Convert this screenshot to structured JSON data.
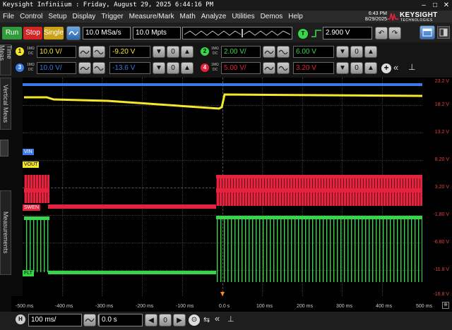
{
  "window": {
    "title": "Keysight Infiniium : Friday, August 29, 2025 6:44:16 PM",
    "date_time": "6:43 PM\n8/29/2025"
  },
  "menu": [
    "File",
    "Control",
    "Setup",
    "Display",
    "Trigger",
    "Measure/Mark",
    "Math",
    "Analyze",
    "Utilities",
    "Demos",
    "Help"
  ],
  "brand": {
    "name": "KEYSIGHT",
    "sub": "TECHNOLOGIES"
  },
  "toolbar": {
    "run": "Run",
    "stop": "Stop",
    "single": "Single",
    "sample_rate": "10.0 MSa/s",
    "memory_depth": "10.0 Mpts",
    "trigger_badge": "T",
    "trigger_level": "2.900 V"
  },
  "side_tabs": {
    "left_top": "Time Meas",
    "left_mid": "Vertical Meas",
    "left_bottom": "Measurements"
  },
  "channels": [
    {
      "num": "1",
      "imp": "1MΩ",
      "cpl": "DC",
      "scale": "10.0 V/",
      "offset": "-9.20 V",
      "color": "#f5e82a"
    },
    {
      "num": "2",
      "imp": "1MΩ",
      "cpl": "DC",
      "scale": "2.00 V/",
      "offset": "6.00 V",
      "color": "#36d64a"
    },
    {
      "num": "3",
      "imp": "1MΩ",
      "cpl": "DC",
      "scale": "10.0 V/",
      "offset": "-13.6 V",
      "color": "#3c78e6"
    },
    {
      "num": "4",
      "imp": "1MΩ",
      "cpl": "DC",
      "scale": "5.00 V/",
      "offset": "3.20 V",
      "color": "#e6233f"
    }
  ],
  "zero_label": "0",
  "graph": {
    "y_labels": [
      "23.2 V",
      "18.2 V",
      "13.2 V",
      "8.20 V",
      "3.20 V",
      "-1.80 V",
      "-6.80 V",
      "-11.8 V",
      "-16.8 V"
    ],
    "x_labels": [
      "-500 ms",
      "-400 ms",
      "-300 ms",
      "-200 ms",
      "-100 ms",
      "0.0 s",
      "100 ms",
      "200 ms",
      "300 ms",
      "400 ms",
      "500 ms"
    ],
    "markers": {
      "vin": "VIN",
      "vout": "VOUT",
      "swen": "SWEN",
      "flt": "FLT"
    }
  },
  "bottom": {
    "h_badge": "H",
    "timebase": "100 ms/",
    "position": "0.0 s"
  },
  "colors": {
    "yellow": "#f5e82a",
    "green": "#36d64a",
    "blue": "#3c78e6",
    "red": "#e6233f"
  }
}
